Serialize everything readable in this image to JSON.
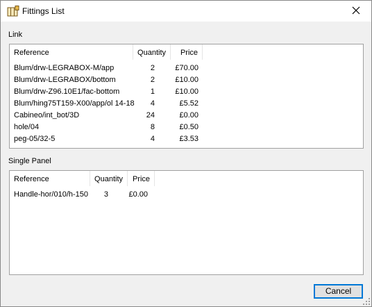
{
  "window": {
    "title": "Fittings List"
  },
  "link_group": {
    "label": "Link",
    "columns": [
      "Reference",
      "Quantity",
      "Price"
    ],
    "rows": [
      [
        "Blum/drw-LEGRABOX-M/app",
        "2",
        "£70.00"
      ],
      [
        "Blum/drw-LEGRABOX/bottom",
        "2",
        "£10.00"
      ],
      [
        "Blum/drw-Z96.10E1/fac-bottom",
        "1",
        "£10.00"
      ],
      [
        "Blum/hing75T159-X00/app/ol 14-18",
        "4",
        "£5.52"
      ],
      [
        "Cabineo/int_bot/3D",
        "24",
        "£0.00"
      ],
      [
        "hole/04",
        "8",
        "£0.50"
      ],
      [
        "peg-05/32-5",
        "4",
        "£3.53"
      ]
    ]
  },
  "single_panel_group": {
    "label": "Single Panel",
    "columns": [
      "Reference",
      "Quantity",
      "Price"
    ],
    "rows": [
      [
        "Handle-hor/010/h-150",
        "3",
        "£0.00"
      ]
    ]
  },
  "footer": {
    "cancel_label": "Cancel"
  },
  "icons": {
    "app": "fittings-app-icon",
    "close": "close-icon"
  }
}
